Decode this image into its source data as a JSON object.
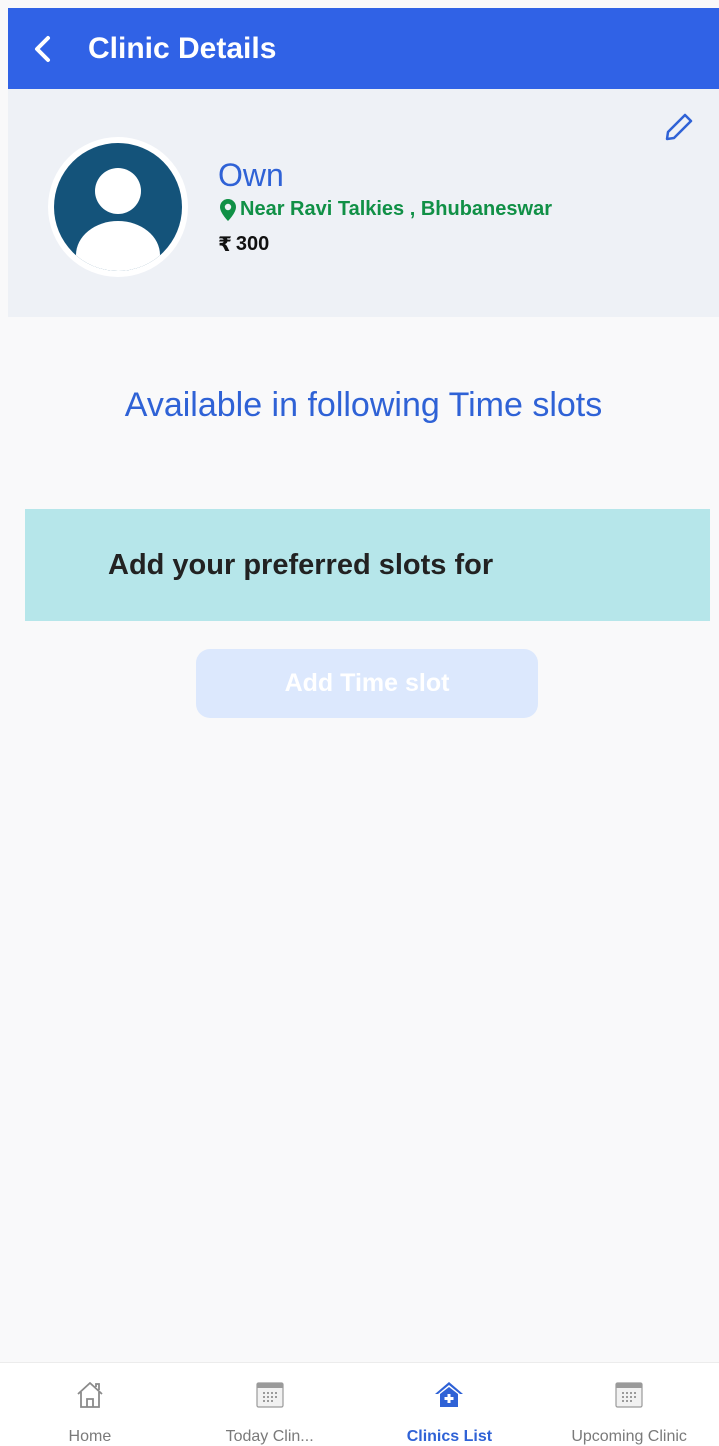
{
  "header": {
    "title": "Clinic Details"
  },
  "clinic": {
    "name": "Own",
    "address": "Near Ravi Talkies , Bhubaneswar",
    "fee": "300",
    "currency_symbol": "₹"
  },
  "slots": {
    "section_title": "Available in following Time slots",
    "banner_text": "Add your preferred slots for",
    "add_button_label": "Add Time slot"
  },
  "nav": {
    "items": [
      {
        "label": "Home",
        "icon": "home-icon",
        "active": false
      },
      {
        "label": "Today Clin...",
        "icon": "calendar-icon",
        "active": false
      },
      {
        "label": "Clinics List",
        "icon": "clinic-house-icon",
        "active": true
      },
      {
        "label": "Upcoming Clinic",
        "icon": "calendar-icon",
        "active": false
      }
    ]
  },
  "colors": {
    "primary": "#3062e6",
    "accent_text": "#2f62d6",
    "address_green": "#109046",
    "banner": "#b6e6ea",
    "avatar": "#14537a"
  }
}
